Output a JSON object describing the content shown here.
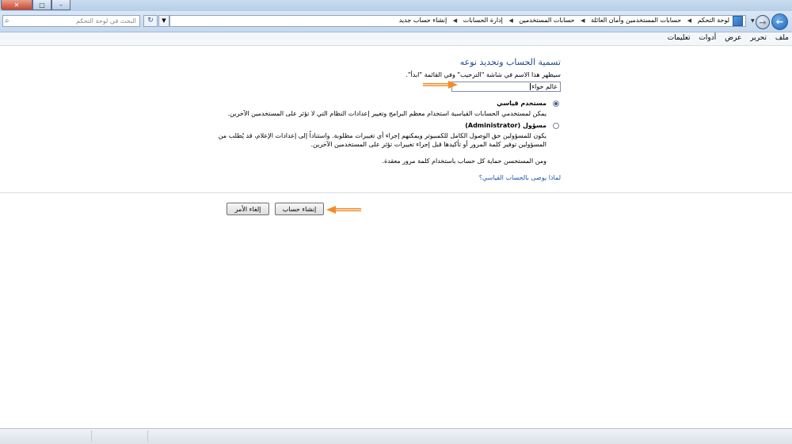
{
  "window": {
    "close_glyph": "✕",
    "maximize_glyph": "□",
    "minimize_glyph": "–"
  },
  "address_bar": {
    "breadcrumbs": [
      "لوحة التحكم",
      "حسابات المستخدمين وأمان العائلة",
      "حسابات المستخدمين",
      "إدارة الحسابات",
      "إنشاء حساب جديد"
    ],
    "search_placeholder": "البحث في لوحة التحكم",
    "refresh_glyph": "↻",
    "dropdown_glyph": "▼",
    "separator_glyph": "◀",
    "nav_back_glyph": "←",
    "nav_forward_glyph": "→",
    "search_icon_glyph": "⌕"
  },
  "menu": {
    "items": [
      "ملف",
      "تحرير",
      "عرض",
      "أدوات",
      "تعليمات"
    ]
  },
  "form": {
    "heading": "تسمية الحساب وتحديد نوعه",
    "name_hint": "سيظهر هذا الاسم في شاشة \"الترحيب\" وفي القائمة \"ابدأ\".",
    "name_value": "عالم حواء",
    "standard_label": "مستخدم قياسي",
    "standard_desc": "يمكن لمستخدمي الحسابات القياسية استخدام معظم البرامج وتغيير إعدادات النظام التي لا تؤثر على المستخدمين الآخرين.",
    "admin_label": "مسؤول (Administrator)",
    "admin_desc_line1": "يكون للمسؤولين حق الوصول الكامل للكمبيوتر ويمكنهم إجراء أي تغييرات مطلوبة. واستناداً إلى إعدادات الإعلام، قد يُطلب من",
    "admin_desc_line2": "المسؤولين توفير كلمة المرور أو تأكيدها قبل إجراء تغييرات تؤثر على المستخدمين الآخرين.",
    "password_note": "ومن المستحسن حماية كل حساب باستخدام كلمة مرور معقدة.",
    "why_link": "لماذا يوصى بالحساب القياسي؟",
    "selected": "standard"
  },
  "buttons": {
    "create": "إنشاء حساب",
    "cancel": "إلغاء الأمر"
  },
  "colors": {
    "heading": "#1e4b8e",
    "link": "#1a56a8",
    "annotation_arrow": "#f28c28"
  }
}
